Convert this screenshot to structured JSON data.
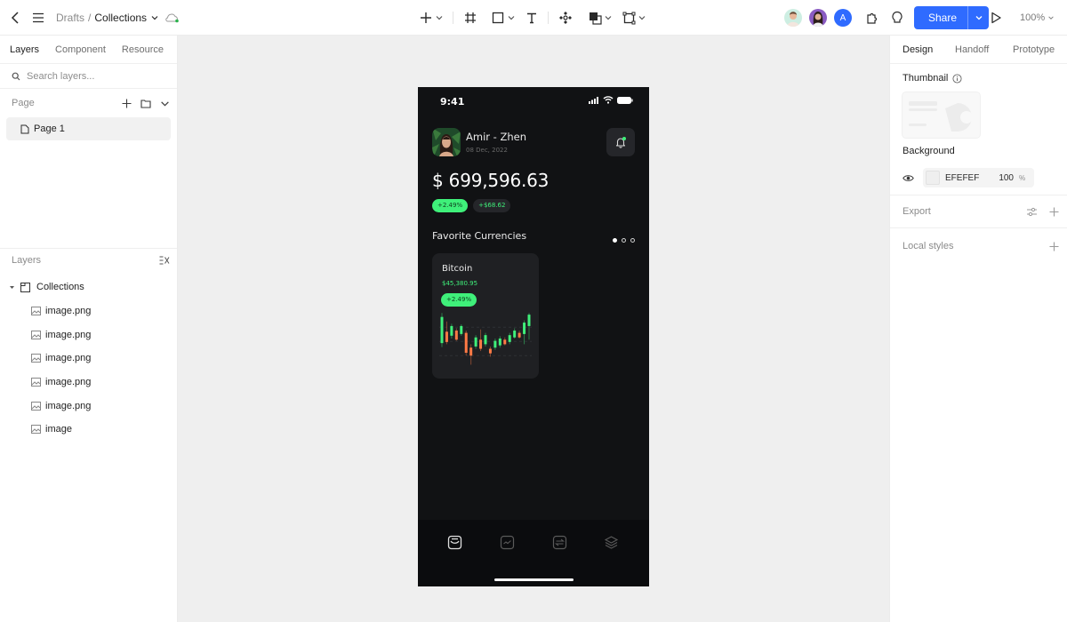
{
  "topbar": {
    "breadcrumb": {
      "parent": "Drafts",
      "separator": "/",
      "current": "Collections"
    },
    "tools": [
      {
        "icon": "plus-icon",
        "has_dropdown": true
      },
      {
        "icon": "frame-icon",
        "has_dropdown": false
      },
      {
        "icon": "rectangle-icon",
        "has_dropdown": true
      },
      {
        "icon": "text-icon",
        "has_dropdown": false
      },
      {
        "icon": "component-icon",
        "has_dropdown": false
      },
      {
        "icon": "boolean-icon",
        "has_dropdown": true
      },
      {
        "icon": "selection-box-icon",
        "has_dropdown": true
      }
    ],
    "collaborators": [
      {
        "type": "photo",
        "color": "#cdeee2"
      },
      {
        "type": "photo",
        "color": "#8a5bc2"
      },
      {
        "type": "initial",
        "initial": "A",
        "color": "#2f6bff"
      }
    ],
    "share_label": "Share",
    "zoom_level": "100%",
    "accent_color": "#2f6bff"
  },
  "left_panel": {
    "tabs": [
      {
        "label": "Layers",
        "active": true
      },
      {
        "label": "Component",
        "active": false
      },
      {
        "label": "Resource",
        "active": false
      }
    ],
    "search": {
      "placeholder": "Search layers...",
      "value": ""
    },
    "page_section": {
      "title": "Page",
      "pages": [
        {
          "label": "Page 1",
          "selected": true
        }
      ]
    },
    "layers_section": {
      "title": "Layers",
      "root": {
        "label": "Collections",
        "expanded": true
      },
      "children": [
        {
          "label": "image.png"
        },
        {
          "label": "image.png"
        },
        {
          "label": "image.png"
        },
        {
          "label": "image.png"
        },
        {
          "label": "image.png"
        },
        {
          "label": "image"
        }
      ]
    }
  },
  "canvas": {
    "background": "#EFEFEF",
    "phone": {
      "status_time": "9:41",
      "user_name": "Amir - Zhen",
      "date": "08 Dec, 2022",
      "balance": "$ 699,596.63",
      "change_percent": "+2.49%",
      "change_amount": "+$68.62",
      "favorites_title": "Favorite Currencies",
      "carousel": {
        "total": 3,
        "active_index": 0
      },
      "coin_card": {
        "name": "Bitcoin",
        "price": "$45,380.95",
        "change": "+2.49%",
        "candles": [
          {
            "dir": "up",
            "o": 42,
            "c": 88,
            "h": 95,
            "l": 35
          },
          {
            "dir": "down",
            "o": 62,
            "c": 44,
            "h": 80,
            "l": 40
          },
          {
            "dir": "up",
            "o": 55,
            "c": 72,
            "h": 76,
            "l": 50
          },
          {
            "dir": "down",
            "o": 64,
            "c": 48,
            "h": 68,
            "l": 46
          },
          {
            "dir": "up",
            "o": 58,
            "c": 72,
            "h": 75,
            "l": 55
          },
          {
            "dir": "down",
            "o": 60,
            "c": 25,
            "h": 64,
            "l": 20
          },
          {
            "dir": "down",
            "o": 34,
            "c": 20,
            "h": 40,
            "l": 4
          },
          {
            "dir": "up",
            "o": 36,
            "c": 52,
            "h": 56,
            "l": 32
          },
          {
            "dir": "down",
            "o": 48,
            "c": 32,
            "h": 66,
            "l": 28
          },
          {
            "dir": "up",
            "o": 40,
            "c": 56,
            "h": 60,
            "l": 36
          },
          {
            "dir": "down",
            "o": 32,
            "c": 24,
            "h": 36,
            "l": 18
          },
          {
            "dir": "up",
            "o": 34,
            "c": 46,
            "h": 50,
            "l": 30
          },
          {
            "dir": "up",
            "o": 38,
            "c": 50,
            "h": 54,
            "l": 34
          },
          {
            "dir": "down",
            "o": 48,
            "c": 40,
            "h": 52,
            "l": 38
          },
          {
            "dir": "up",
            "o": 44,
            "c": 56,
            "h": 60,
            "l": 40
          },
          {
            "dir": "up",
            "o": 52,
            "c": 64,
            "h": 68,
            "l": 50
          },
          {
            "dir": "down",
            "o": 60,
            "c": 52,
            "h": 64,
            "l": 50
          },
          {
            "dir": "up",
            "o": 58,
            "c": 78,
            "h": 82,
            "l": 40
          },
          {
            "dir": "up",
            "o": 72,
            "c": 92,
            "h": 95,
            "l": 48
          }
        ],
        "up_color": "#3ff07a",
        "down_color": "#ff7a45"
      },
      "tabbar": [
        {
          "icon": "wallet-icon",
          "active": true
        },
        {
          "icon": "chart-icon",
          "active": false
        },
        {
          "icon": "exchange-icon",
          "active": false
        },
        {
          "icon": "layers-icon",
          "active": false
        }
      ]
    }
  },
  "right_panel": {
    "tabs": [
      {
        "label": "Design",
        "active": true
      },
      {
        "label": "Handoff",
        "active": false
      },
      {
        "label": "Prototype",
        "active": false
      }
    ],
    "thumbnail_label": "Thumbnail",
    "background_label": "Background",
    "background": {
      "hex": "EFEFEF",
      "opacity": "100",
      "unit": "%"
    },
    "export_label": "Export",
    "local_styles_label": "Local styles"
  }
}
